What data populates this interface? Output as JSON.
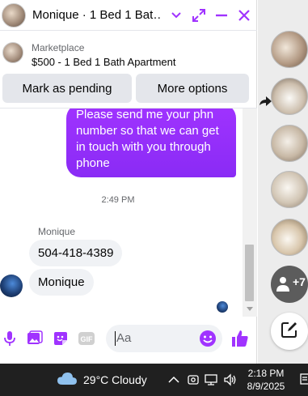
{
  "header": {
    "title": "Monique · 1 Bed 1 Bat…",
    "accent": "#a033ff"
  },
  "marketplace": {
    "label": "Marketplace",
    "item": "$500 - 1 Bed 1 Bath Apartment"
  },
  "actions": {
    "pending": "Mark as pending",
    "more": "More options"
  },
  "messages": {
    "outgoing": "Please send me your phn number so that we can get in touch with you through phone",
    "timestamp": "2:49 PM",
    "sender": "Monique",
    "incoming": [
      "504-418-4389",
      "Monique"
    ]
  },
  "composer": {
    "placeholder": "Aa",
    "gif_label": "GIF"
  },
  "rail": {
    "more_count": "+7"
  },
  "taskbar": {
    "weather": "29°C  Cloudy",
    "time": "2:18 PM",
    "date": "8/9/2025"
  },
  "colors": {
    "brand_purple": "#a033ff",
    "like_blue": "#0a7cff",
    "taskbar_bg": "#202020"
  }
}
